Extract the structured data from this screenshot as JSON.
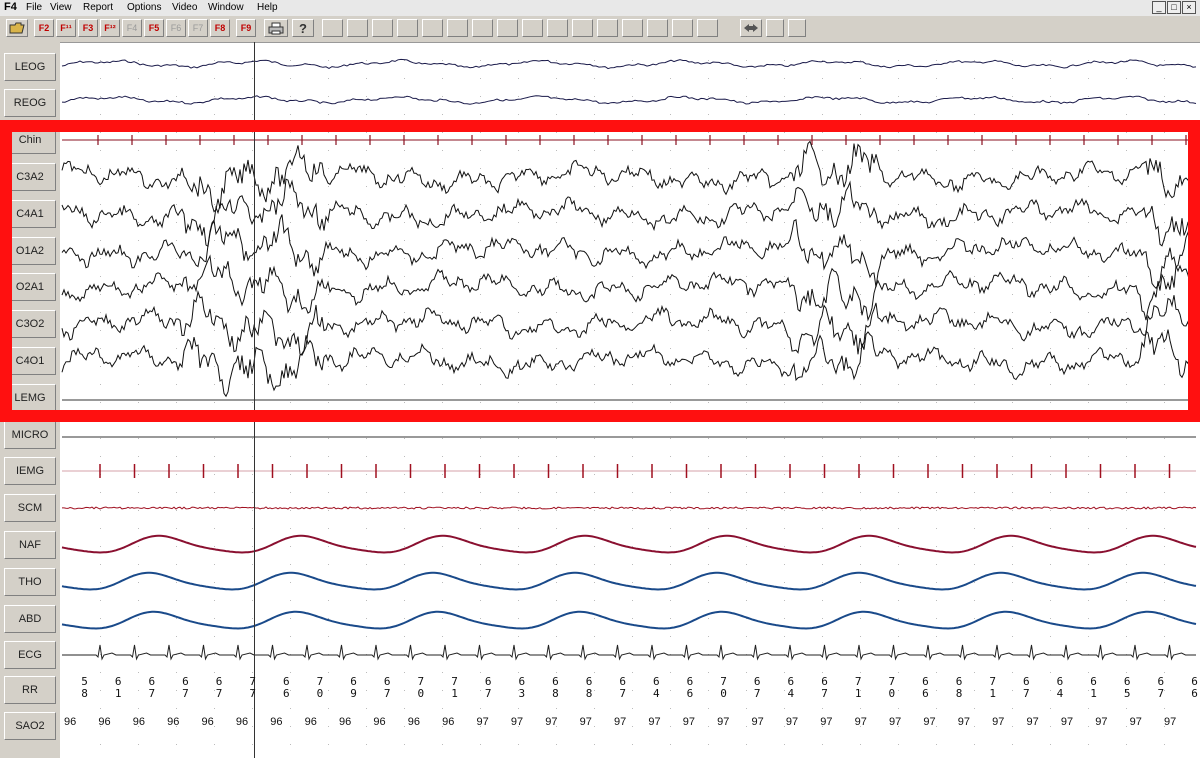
{
  "app_title": "F4",
  "menu": [
    "File",
    "View",
    "Report",
    "Options",
    "Video",
    "Window",
    "Help"
  ],
  "window_controls": [
    "_",
    "□",
    "×"
  ],
  "toolbar": {
    "fkeys": [
      {
        "label": "F2",
        "enabled": true
      },
      {
        "label": "F¹¹",
        "enabled": true
      },
      {
        "label": "F3",
        "enabled": true
      },
      {
        "label": "F¹²",
        "enabled": true
      },
      {
        "label": "F4",
        "enabled": false
      },
      {
        "label": "F5",
        "enabled": true
      },
      {
        "label": "F6",
        "enabled": false
      },
      {
        "label": "F7",
        "enabled": false
      },
      {
        "label": "F8",
        "enabled": true
      },
      {
        "label": "F9",
        "enabled": true
      }
    ],
    "icons": [
      "open-folder-icon",
      "print-icon",
      "help-icon",
      "navigate-icon"
    ]
  },
  "channels": [
    {
      "name": "LEOG",
      "type": "eog",
      "color": "#1a1a4a"
    },
    {
      "name": "REOG",
      "type": "eog",
      "color": "#1a1a4a"
    },
    {
      "name": "Chin",
      "type": "chin",
      "color": "#8a1020"
    },
    {
      "name": "C3A2",
      "type": "eeg",
      "color": "#111111"
    },
    {
      "name": "C4A1",
      "type": "eeg",
      "color": "#111111"
    },
    {
      "name": "O1A2",
      "type": "eeg",
      "color": "#111111"
    },
    {
      "name": "O2A1",
      "type": "eeg",
      "color": "#111111"
    },
    {
      "name": "C3O2",
      "type": "eeg",
      "color": "#111111"
    },
    {
      "name": "C4O1",
      "type": "eeg",
      "color": "#111111"
    },
    {
      "name": "LEMG",
      "type": "flat",
      "color": "#333333"
    },
    {
      "name": "MICRO",
      "type": "flat",
      "color": "#333333"
    },
    {
      "name": "IEMG",
      "type": "spikes",
      "color": "#a01020"
    },
    {
      "name": "SCM",
      "type": "scm",
      "color": "#a01020"
    },
    {
      "name": "NAF",
      "type": "resp",
      "color": "#8a1030"
    },
    {
      "name": "THO",
      "type": "resp",
      "color": "#1a4a8a"
    },
    {
      "name": "ABD",
      "type": "resp",
      "color": "#1a4a8a"
    },
    {
      "name": "ECG",
      "type": "ecg",
      "color": "#222222"
    },
    {
      "name": "RR",
      "type": "text",
      "color": "#111111"
    },
    {
      "name": "SAO2",
      "type": "text",
      "color": "#111111"
    }
  ],
  "rr_values": [
    "58",
    "61",
    "67",
    "67",
    "67",
    "77",
    "66",
    "70",
    "69",
    "67",
    "70",
    "71",
    "67",
    "63",
    "68",
    "68",
    "67",
    "64",
    "66",
    "70",
    "67",
    "64",
    "67",
    "71",
    "70",
    "66",
    "68",
    "71",
    "67",
    "64",
    "61",
    "65",
    "67",
    "66"
  ],
  "sao2_values": [
    "96",
    "96",
    "96",
    "96",
    "96",
    "96",
    "96",
    "96",
    "96",
    "96",
    "96",
    "96",
    "97",
    "97",
    "97",
    "97",
    "97",
    "97",
    "97",
    "97",
    "97",
    "97",
    "97",
    "97",
    "97",
    "97",
    "97",
    "97",
    "97",
    "97",
    "97",
    "97",
    "97"
  ]
}
